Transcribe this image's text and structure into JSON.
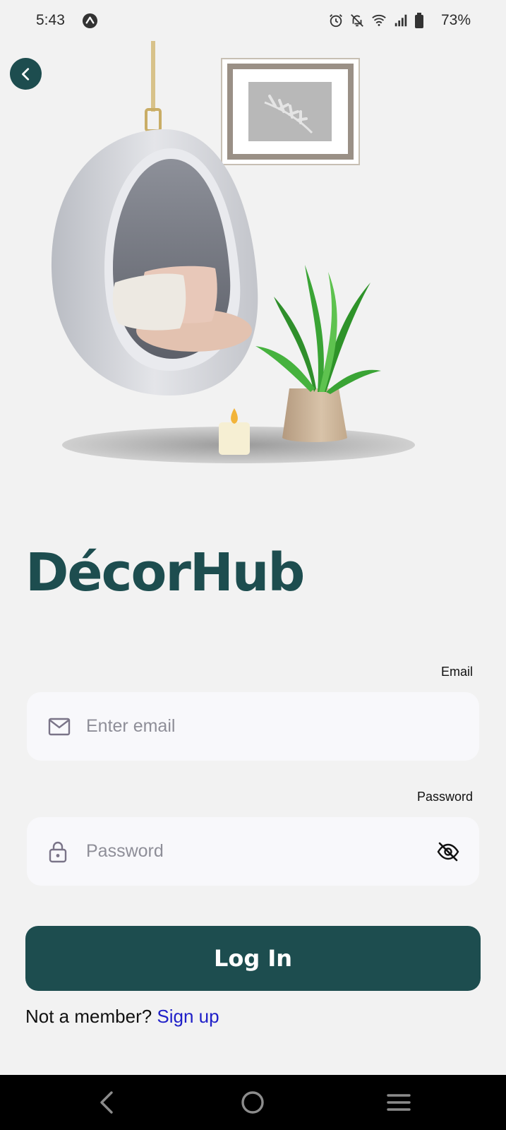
{
  "status_bar": {
    "time": "5:43",
    "battery": "73%",
    "icons": [
      "app-a-icon",
      "alarm-icon",
      "bell-off-icon",
      "wifi-icon",
      "signal-icon",
      "battery-icon"
    ]
  },
  "header": {
    "back_icon": "chevron-left-icon"
  },
  "hero": {
    "illustration": "hanging-egg-chair-with-plant-candle-and-framed-leaf-print"
  },
  "brand": {
    "title": "DécorHub",
    "color": "#1d4d4f"
  },
  "form": {
    "email": {
      "label": "Email",
      "placeholder": "Enter email",
      "value": "",
      "icon": "mail-icon"
    },
    "password": {
      "label": "Password",
      "placeholder": "Password",
      "value": "",
      "icon": "lock-icon",
      "toggle_icon": "eye-off-icon"
    },
    "login_label": "Log In"
  },
  "signup": {
    "prompt": "Not a member?",
    "link": "Sign up",
    "link_color": "#2020c8"
  },
  "nav_bar": {
    "items": [
      "back-icon",
      "home-icon",
      "recents-icon"
    ]
  }
}
